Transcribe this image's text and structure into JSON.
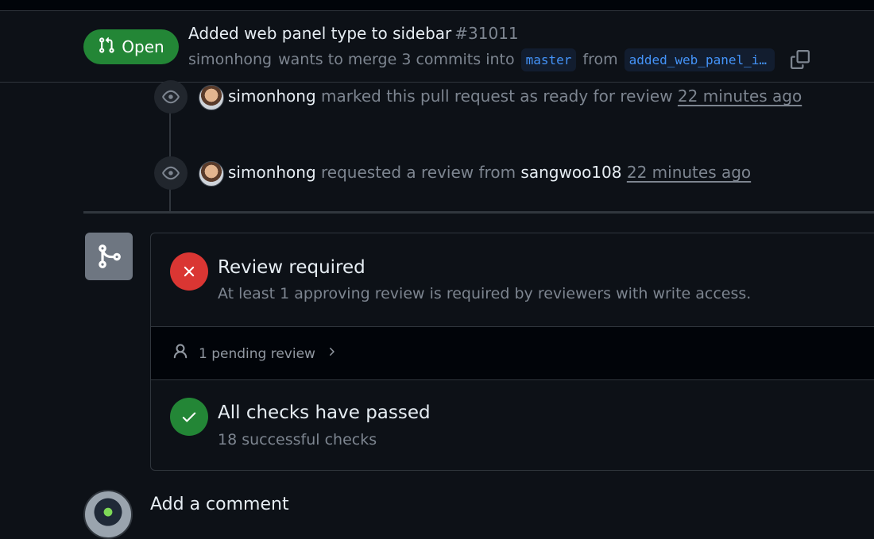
{
  "pr": {
    "state": "Open",
    "title": "Added web panel type to sidebar",
    "number": "#31011",
    "author": "simonhong",
    "merge_text": "wants to merge 3 commits into",
    "base_branch": "master",
    "from_text": "from",
    "head_branch": "added_web_panel_i…"
  },
  "timeline": [
    {
      "actor": "simonhong",
      "text": "marked this pull request as ready for review",
      "time": "22 minutes ago",
      "icon": "eye-icon"
    },
    {
      "actor": "simonhong",
      "text": "requested a review from",
      "target": "sangwoo108",
      "time": "22 minutes ago",
      "icon": "eye-icon"
    }
  ],
  "merge_box": {
    "review": {
      "title": "Review required",
      "desc": "At least 1 approving review is required by reviewers with write access.",
      "icon": "x-icon"
    },
    "pending": {
      "label": "1 pending review",
      "icon": "person-icon"
    },
    "checks": {
      "title": "All checks have passed",
      "desc": "18 successful checks",
      "icon": "check-icon"
    }
  },
  "comment": {
    "title": "Add a comment"
  },
  "colors": {
    "open": "#238636",
    "fail": "#da3633",
    "link": "#4493f8",
    "bg": "#0d1117",
    "border": "#30363d"
  }
}
